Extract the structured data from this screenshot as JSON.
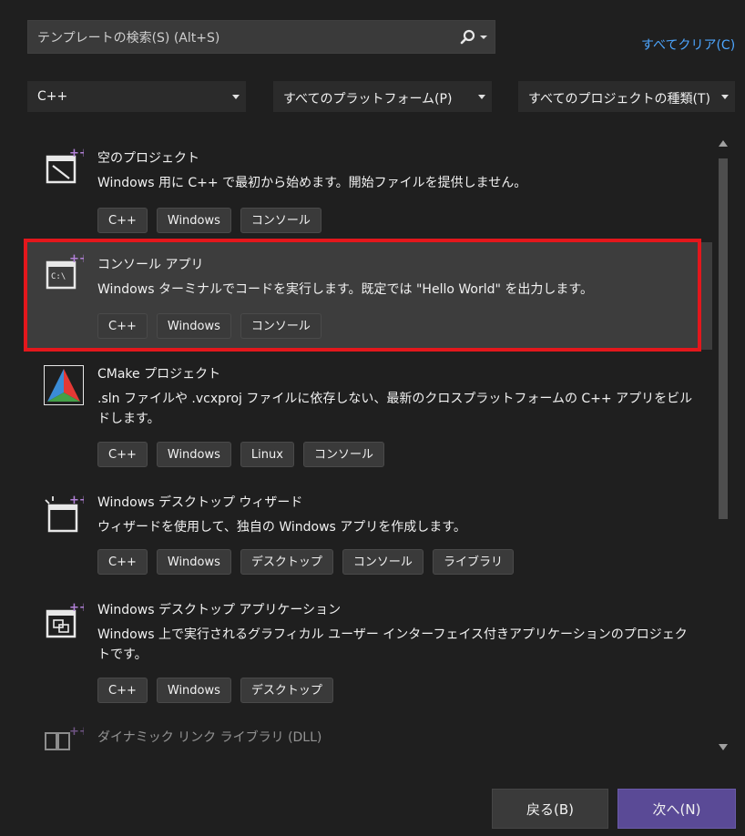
{
  "search": {
    "placeholder": "テンプレートの検索(S) (Alt+S)"
  },
  "clear_all": "すべてクリア(C)",
  "filters": {
    "language": "C++",
    "platform": "すべてのプラットフォーム(P)",
    "project_type": "すべてのプロジェクトの種類(T)"
  },
  "templates": [
    {
      "title": "空のプロジェクト",
      "desc": "Windows 用に C++ で最初から始めます。開始ファイルを提供しません。",
      "tags": [
        "C++",
        "Windows",
        "コンソール"
      ]
    },
    {
      "title": "コンソール アプリ",
      "desc": "Windows ターミナルでコードを実行します。既定では \"Hello World\" を出力します。",
      "tags": [
        "C++",
        "Windows",
        "コンソール"
      ],
      "icon_text": "C:\\"
    },
    {
      "title": "CMake プロジェクト",
      "desc": ".sln ファイルや .vcxproj ファイルに依存しない、最新のクロスプラットフォームの C++ アプリをビルドします。",
      "tags": [
        "C++",
        "Windows",
        "Linux",
        "コンソール"
      ]
    },
    {
      "title": "Windows デスクトップ ウィザード",
      "desc": "ウィザードを使用して、独自の Windows アプリを作成します。",
      "tags": [
        "C++",
        "Windows",
        "デスクトップ",
        "コンソール",
        "ライブラリ"
      ]
    },
    {
      "title": "Windows デスクトップ アプリケーション",
      "desc": "Windows 上で実行されるグラフィカル ユーザー インターフェイス付きアプリケーションのプロジェクトです。",
      "tags": [
        "C++",
        "Windows",
        "デスクトップ"
      ]
    },
    {
      "title": "ダイナミック リンク ライブラリ (DLL)"
    }
  ],
  "buttons": {
    "back": "戻る(B)",
    "next": "次へ(N)"
  },
  "colors": {
    "accent": "#5a4a96",
    "link": "#4da6ff",
    "highlight": "#e3171c",
    "new_badge": "#b180d7"
  }
}
